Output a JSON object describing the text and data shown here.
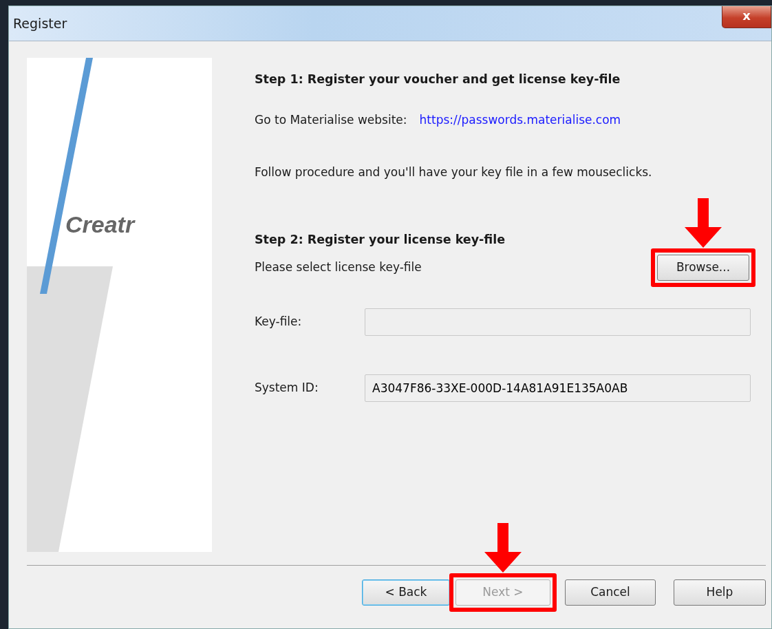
{
  "window": {
    "title": "Register",
    "close_label": "x"
  },
  "logo": {
    "text": "Creatr"
  },
  "step1": {
    "heading": "Step 1: Register your voucher and get license key-file",
    "website_label": "Go to Materialise website:",
    "link": "https://passwords.materialise.com",
    "instruction": "Follow procedure and you'll have your key file in a few mouseclicks."
  },
  "step2": {
    "heading": "Step 2: Register your license key-file",
    "prompt": "Please select license key-file",
    "browse_button": {
      "label": "Browse...",
      "highlighted": true
    }
  },
  "fields": [
    {
      "label": "Key-file:"
    },
    {
      "label": "System ID:",
      "value": "A3047F86-33XE-000D-14A81A91E135A0AB"
    }
  ],
  "buttons": [
    {
      "label": "< Back",
      "disabled": false,
      "focused": true,
      "highlighted": false
    },
    {
      "label": "Next >",
      "disabled": true,
      "focused": false,
      "highlighted": true
    },
    {
      "label": "Cancel",
      "disabled": false,
      "focused": false,
      "highlighted": false
    },
    {
      "label": "Help",
      "disabled": false,
      "focused": false,
      "highlighted": false
    }
  ]
}
